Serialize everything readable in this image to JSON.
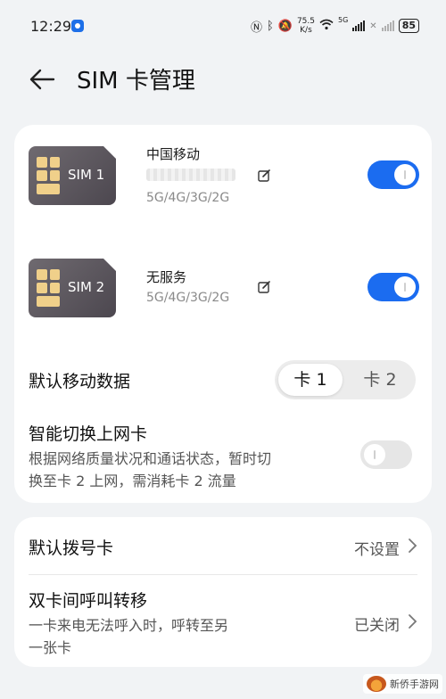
{
  "status_bar": {
    "time": "12:29",
    "net_speed_value": "75.5",
    "net_speed_unit": "K/s",
    "sim_tag": "5G",
    "battery": "85"
  },
  "header": {
    "title": "SIM 卡管理"
  },
  "sims": [
    {
      "chip_label": "SIM 1",
      "carrier": "中国移动",
      "network": "5G/4G/3G/2G",
      "enabled": true
    },
    {
      "chip_label": "SIM 2",
      "carrier": "无服务",
      "network": "5G/4G/3G/2G",
      "enabled": true
    }
  ],
  "default_data": {
    "label": "默认移动数据",
    "options": [
      "卡 1",
      "卡 2"
    ],
    "selected": "卡 1"
  },
  "smart_switch": {
    "title": "智能切换上网卡",
    "desc_line1": "根据网络质量状况和通话状态，暂时切",
    "desc_line2": "换至卡 2 上网，需消耗卡 2 流量",
    "enabled": false
  },
  "default_call": {
    "label": "默认拨号卡",
    "value": "不设置"
  },
  "call_forward": {
    "title": "双卡间呼叫转移",
    "desc_line1": "一卡来电无法呼入时，呼转至另",
    "desc_line2": "一张卡",
    "value": "已关闭"
  },
  "watermark": {
    "text": "新侨手游网"
  },
  "colors": {
    "accent": "#1b6cf0",
    "background": "#f1f3f5",
    "card": "#ffffff"
  }
}
